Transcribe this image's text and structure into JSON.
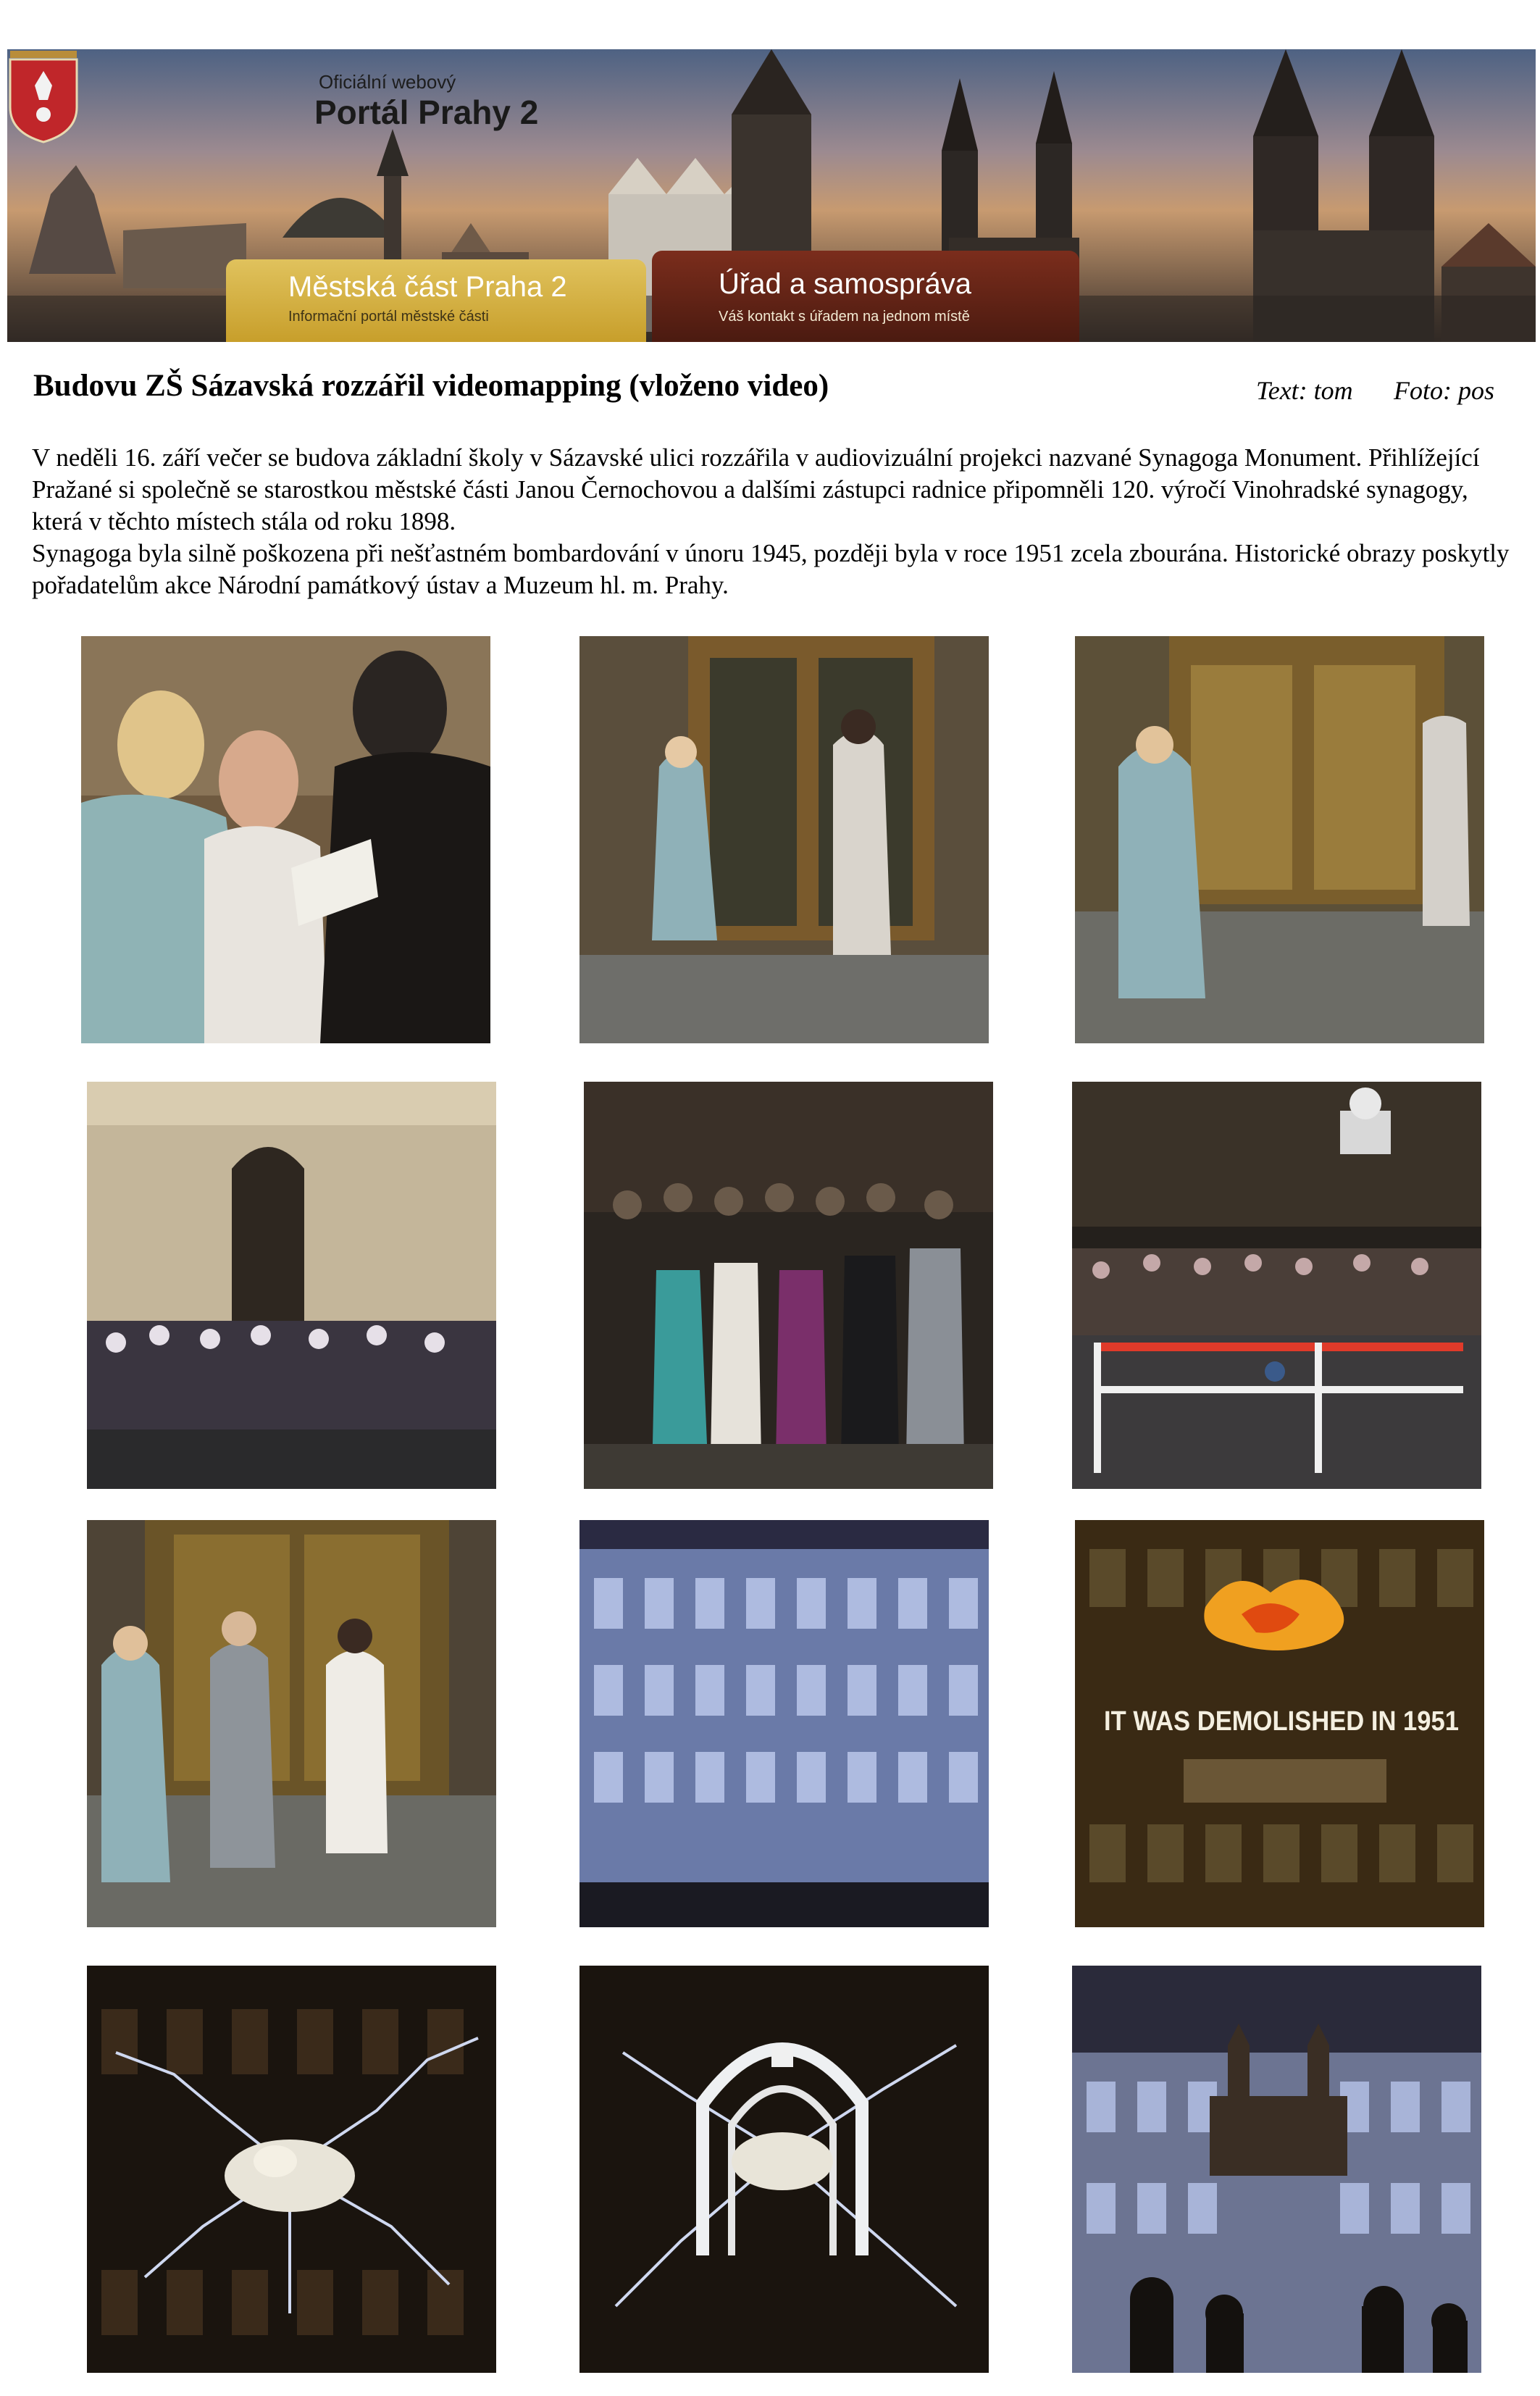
{
  "header": {
    "portal_small": "Oficiální webový",
    "portal_big": "Portál Prahy 2",
    "tab1_title": "Městská část Praha 2",
    "tab1_sub": "Informační portál městské části",
    "tab2_title": "Úřad a samospráva",
    "tab2_sub": "Váš kontakt s úřadem na jednom místě"
  },
  "article": {
    "headline": "Budovu ZŠ Sázavská rozzářil videomapping (vloženo video)",
    "text_credit": "Text: tom",
    "photo_credit": "Foto: pos",
    "paragraph1": "V neděli 16. září večer se budova základní školy v Sázavské ulici rozzářila v audiovizuální projekci nazvané Synagoga Monument. Přihlížející Pražané si společně se starostkou městské části Janou Černochovou a dalšími zástupci radnice připomněli 120. výročí Vinohradské synagogy, která v těchto místech stála od roku 1898.",
    "paragraph2": "Synagoga byla silně poškozena při nešťastném bombardování v únoru 1945, později byla v roce 1951 zcela zbourána. Historické obrazy poskytly pořadatelům akce Národní památkový ústav a Muzeum hl. m. Prahy."
  },
  "photos": {
    "projection_text": "IT WAS DEMOLISHED IN 1951"
  }
}
